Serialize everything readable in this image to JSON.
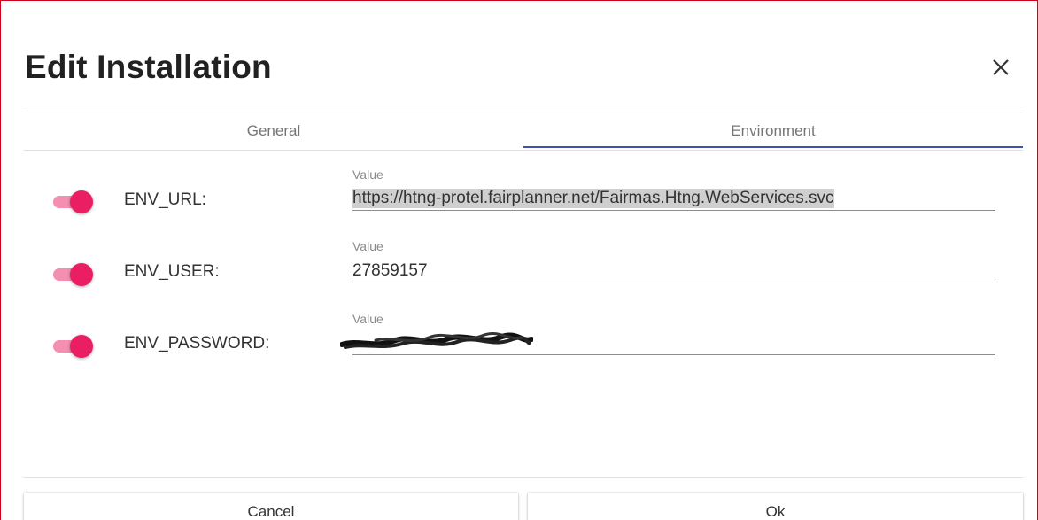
{
  "dialog": {
    "title": "Edit Installation",
    "close_icon": "close-icon"
  },
  "tabs": [
    {
      "label": "General",
      "active": false
    },
    {
      "label": "Environment",
      "active": true
    }
  ],
  "accent_color": "#3f51b5",
  "toggle_color": "#e91e63",
  "env_rows": [
    {
      "name": "ENV_URL:",
      "field_label": "Value",
      "value": "https://htng-protel.fairplanner.net/Fairmas.Htng.WebServices.svc",
      "enabled": true
    },
    {
      "name": "ENV_USER:",
      "field_label": "Value",
      "value": "27859157",
      "enabled": true
    },
    {
      "name": "ENV_PASSWORD:",
      "field_label": "Value",
      "value": "",
      "enabled": true,
      "redacted": true
    }
  ],
  "actions": {
    "cancel_label": "Cancel",
    "ok_label": "Ok"
  }
}
